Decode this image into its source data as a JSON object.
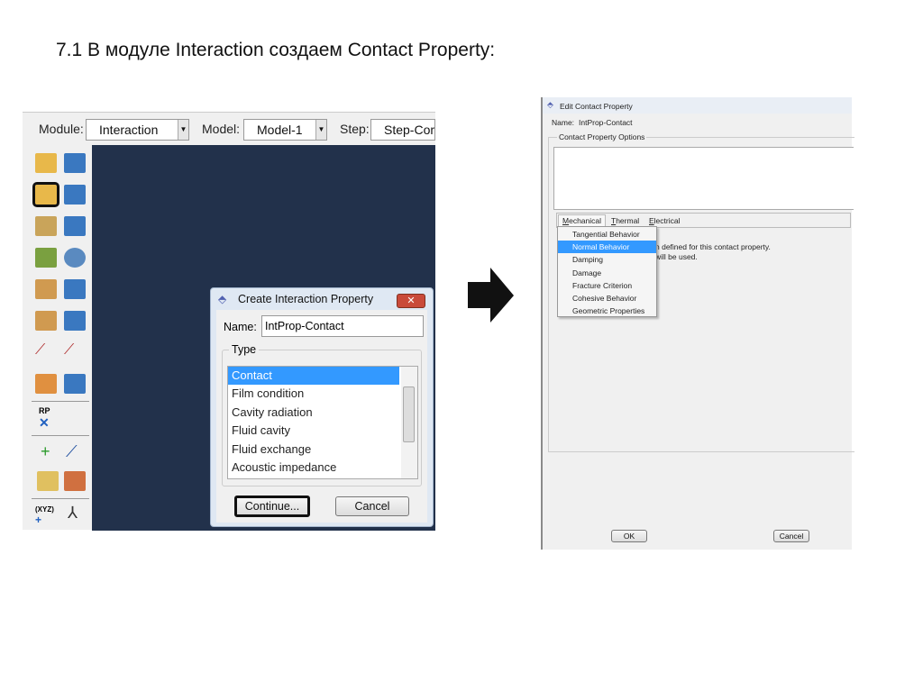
{
  "slide_title": "7.1 В модуле Interaction создаем Contact Property:",
  "toolbar": {
    "module_label": "Module:",
    "module_value": "Interaction",
    "model_label": "Model:",
    "model_value": "Model-1",
    "step_label": "Step:",
    "step_value": "Step-Com"
  },
  "sidebar": {
    "rp_label": "RP",
    "xyz_label": "(XYZ)"
  },
  "create_dialog": {
    "title": "Create Interaction Property",
    "name_label": "Name:",
    "name_value": "IntProp-Contact",
    "type_label": "Type",
    "types": [
      "Contact",
      "Film condition",
      "Cavity radiation",
      "Fluid cavity",
      "Fluid exchange",
      "Acoustic impedance"
    ],
    "selected": "Contact",
    "continue_label": "Continue...",
    "cancel_label": "Cancel"
  },
  "edit_dialog": {
    "title": "Edit Contact Property",
    "name_label": "Name:",
    "name_value": "IntProp-Contact",
    "options_label": "Contact Property Options",
    "tabs": [
      "Mechanical",
      "Thermal",
      "Electrical"
    ],
    "menu_items": [
      "Tangential Behavior",
      "Normal Behavior",
      "Damping",
      "Damage",
      "Fracture Criterion",
      "Cohesive Behavior",
      "Geometric Properties"
    ],
    "highlighted": "Normal Behavior",
    "message_line1": "n defined for this contact property.",
    "message_line2": "will be used.",
    "ok_label": "OK",
    "cancel_label": "Cancel"
  },
  "colors": {
    "selection": "#3399ff",
    "canvas": "#22314b"
  }
}
